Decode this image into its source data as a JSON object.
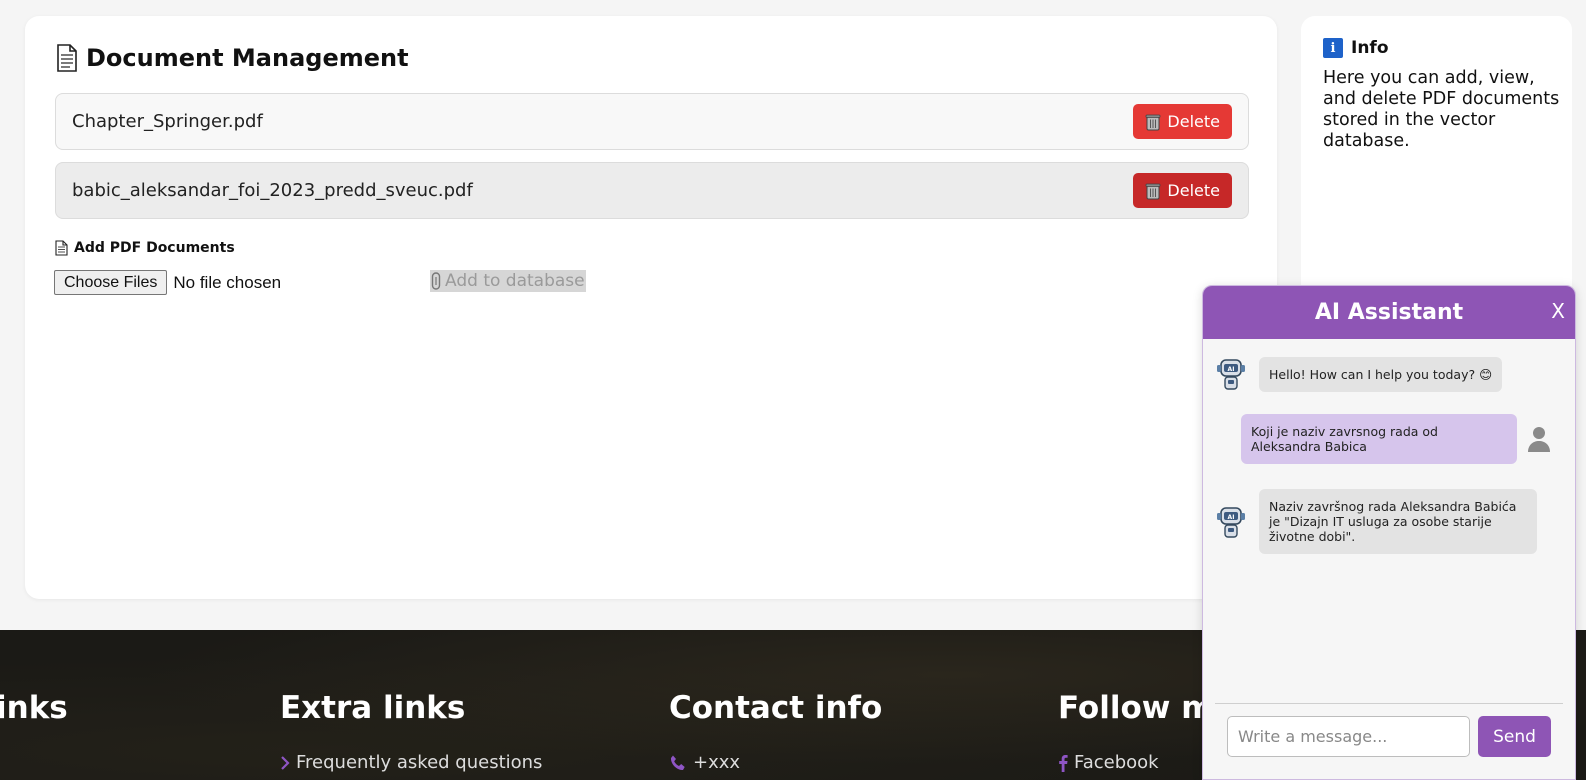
{
  "documents": {
    "title": "Document Management",
    "files": [
      {
        "name": "Chapter_Springer.pdf",
        "delete_label": "Delete"
      },
      {
        "name": "babic_aleksandar_foi_2023_predd_sveuc.pdf",
        "delete_label": "Delete"
      }
    ],
    "add_section": {
      "title": "Add PDF Documents",
      "choose_label": "Choose Files",
      "no_file_text": "No file chosen",
      "add_button_label": "Add to database"
    }
  },
  "info": {
    "title": "Info",
    "text": "Here you can add, view, and delete PDF documents stored in the vector database."
  },
  "footer": {
    "columns": [
      {
        "heading": "inks",
        "link": "",
        "icon": ""
      },
      {
        "heading": "Extra links",
        "link": "Frequently asked questions",
        "icon": "chevron-right-icon"
      },
      {
        "heading": "Contact info",
        "link": "+xxx",
        "icon": "phone-icon"
      },
      {
        "heading": "Follow m",
        "link": "Facebook",
        "icon": "facebook-icon"
      }
    ]
  },
  "chat": {
    "title": "AI Assistant",
    "close_label": "X",
    "messages": [
      {
        "role": "bot",
        "text": "Hello! How can I help you today? 😊"
      },
      {
        "role": "user",
        "text": "Koji je naziv zavrsnog rada od Aleksandra Babica"
      },
      {
        "role": "bot",
        "text": "Naziv završnog rada Aleksandra Babića je \"Dizajn IT usluga za osobe starije životne dobi\"."
      }
    ],
    "input_placeholder": "Write a message...",
    "send_label": "Send"
  },
  "colors": {
    "accent": "#8e55b5",
    "delete_red": "#e53935",
    "delete_red_hover": "#c62828",
    "info_blue": "#1e62c9"
  }
}
